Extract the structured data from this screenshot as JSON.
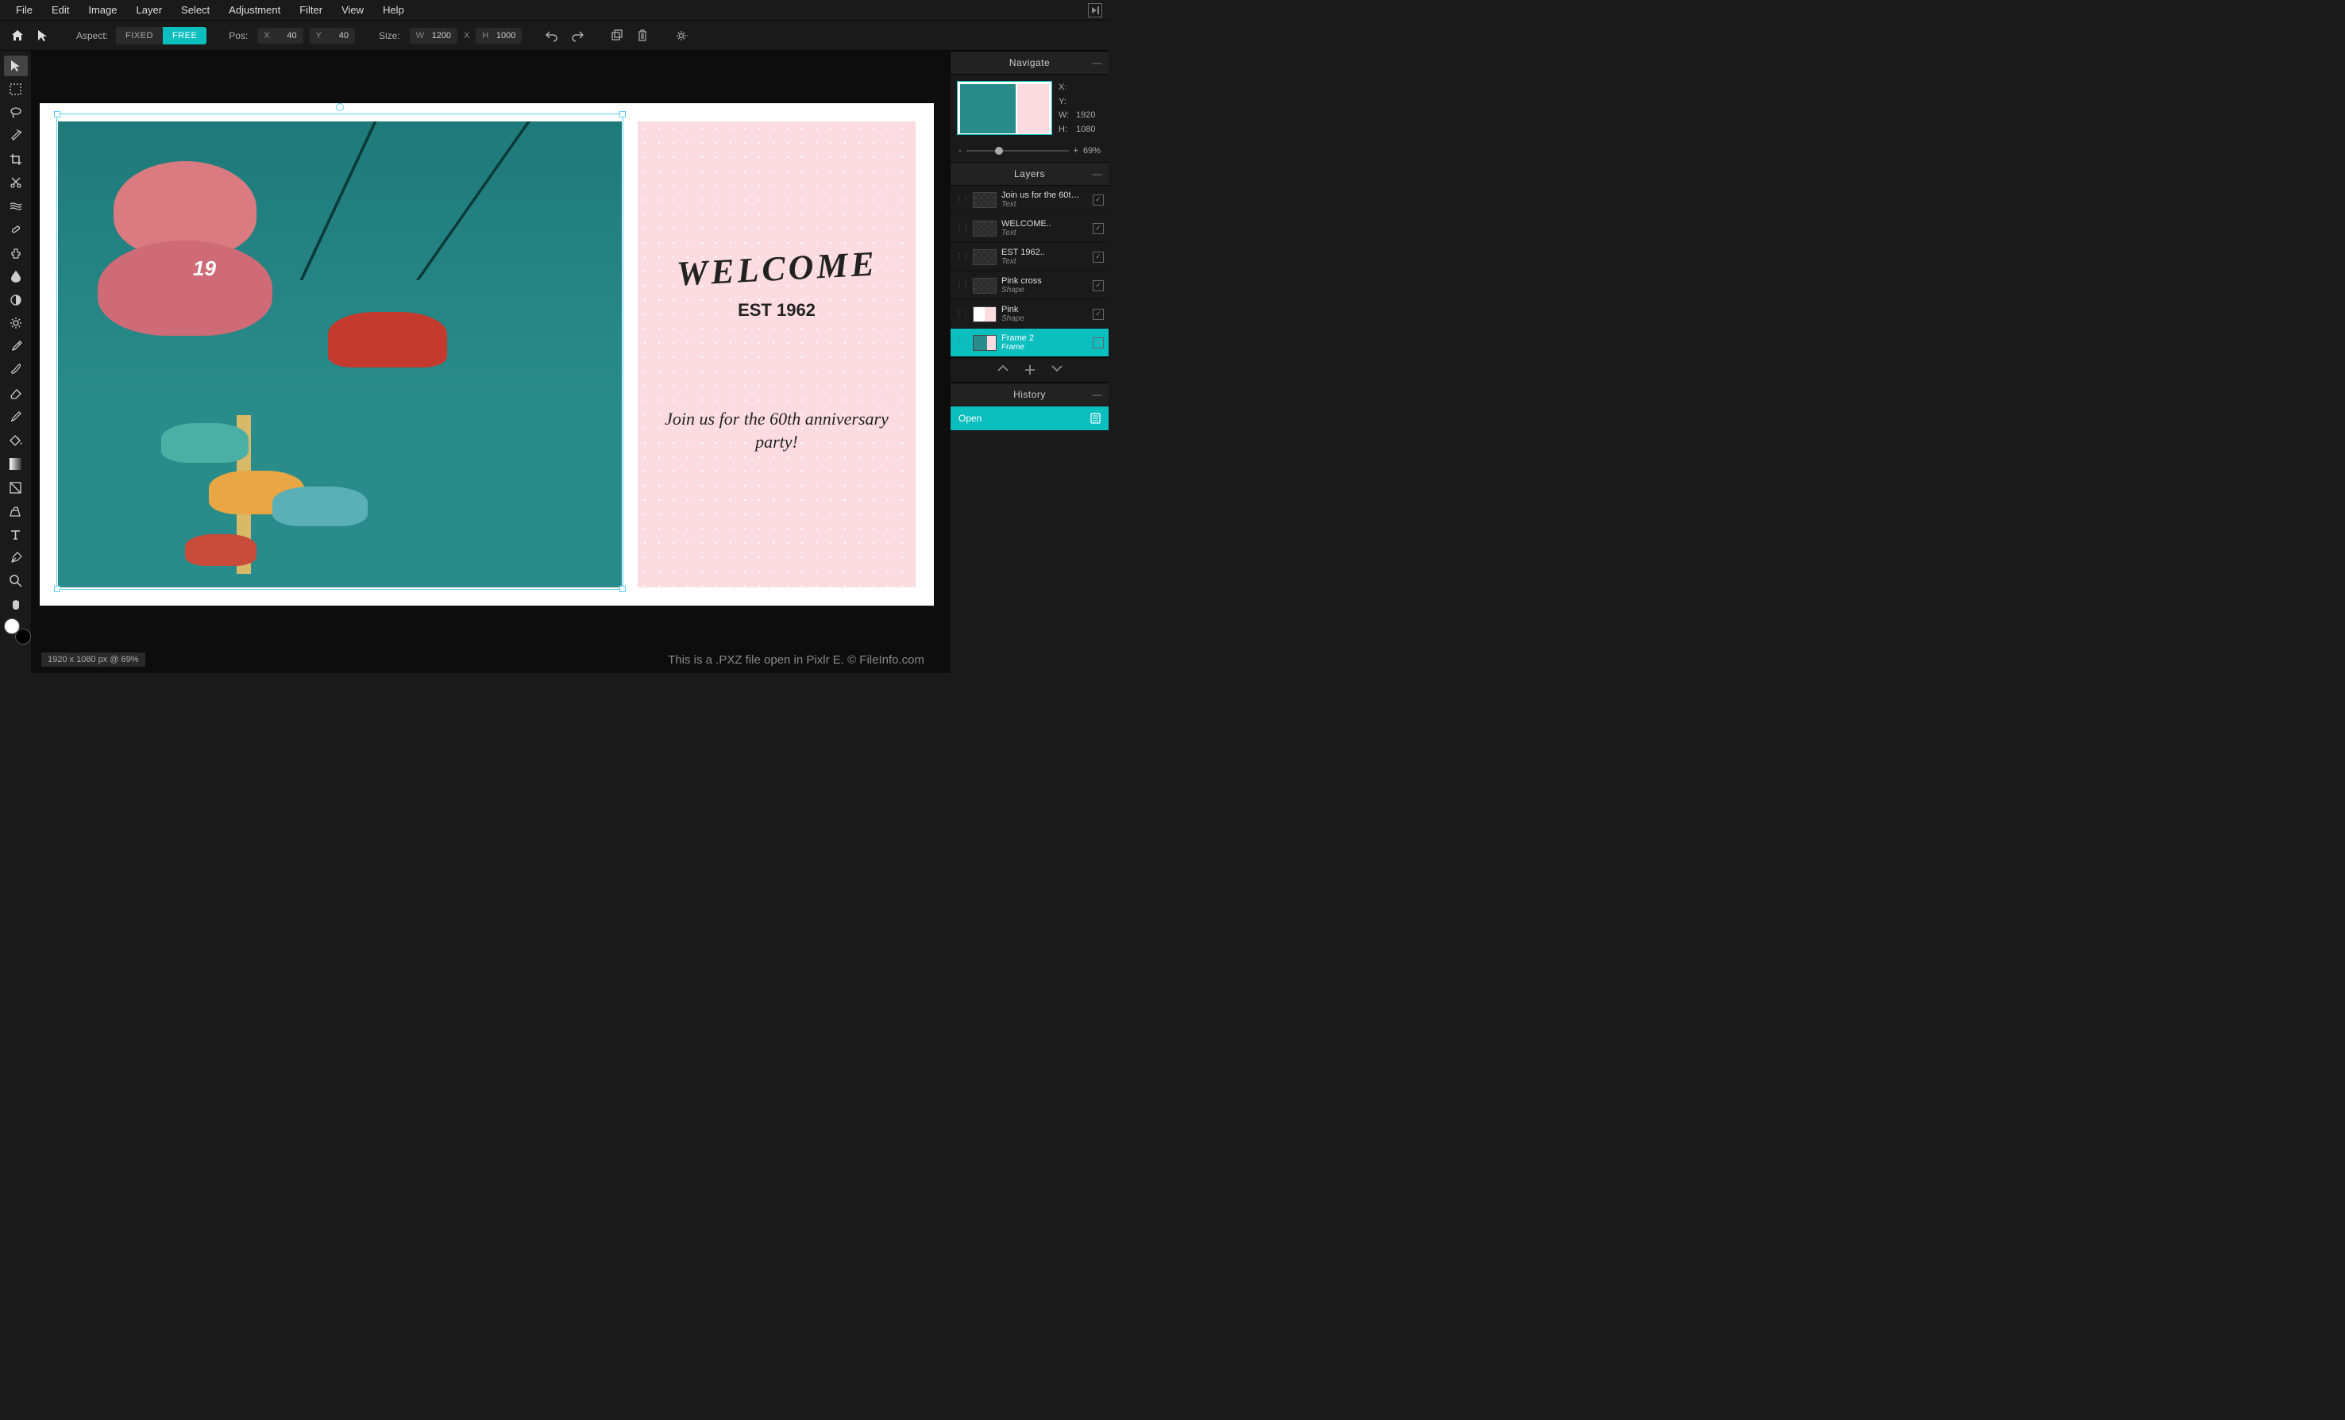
{
  "menubar": {
    "items": [
      "File",
      "Edit",
      "Image",
      "Layer",
      "Select",
      "Adjustment",
      "Filter",
      "View",
      "Help"
    ]
  },
  "toolbar": {
    "aspect_label": "Aspect:",
    "fixed": "FIXED",
    "free": "FREE",
    "pos_label": "Pos:",
    "pos_x_label": "X",
    "pos_x": "40",
    "pos_y_label": "Y",
    "pos_y": "40",
    "size_label": "Size:",
    "size_w_label": "W",
    "size_w": "1200",
    "x_sep": "X",
    "size_h_label": "H",
    "size_h": "1000"
  },
  "tools": [
    "arrow",
    "marquee",
    "lasso",
    "wand",
    "crop",
    "cut",
    "liquify",
    "heal",
    "stamp",
    "blur",
    "vignette",
    "sun",
    "eyedropper",
    "brush",
    "eraser",
    "colorreplace",
    "fill",
    "gradient",
    "nocrop",
    "paint",
    "text",
    "pen",
    "zoom",
    "hand"
  ],
  "canvas_content": {
    "nineteen": "19",
    "welcome": "WELCOME",
    "est": "EST 1962",
    "join": "Join us for the 60th anniversary party!"
  },
  "footer": {
    "status": "1920 x 1080 px @ 69%",
    "credit": "This is a .PXZ file open in Pixlr E. © FileInfo.com"
  },
  "navigate": {
    "title": "Navigate",
    "x_label": "X:",
    "y_label": "Y:",
    "w_label": "W:",
    "w_value": "1920",
    "h_label": "H:",
    "h_value": "1080",
    "zoom_minus": "-",
    "zoom_plus": "+",
    "zoom_pct": "69%"
  },
  "layers_panel": {
    "title": "Layers",
    "layers": [
      {
        "name": "Join us for the 60t…",
        "type": "Text",
        "thumb": "checker",
        "active": false
      },
      {
        "name": "WELCOME..",
        "type": "Text",
        "thumb": "checker",
        "active": false
      },
      {
        "name": "EST 1962..",
        "type": "Text",
        "thumb": "checker",
        "active": false
      },
      {
        "name": "Pink cross",
        "type": "Shape",
        "thumb": "checker",
        "active": false
      },
      {
        "name": "Pink",
        "type": "Shape",
        "thumb": "half",
        "active": false
      },
      {
        "name": "Frame 2",
        "type": "Frame",
        "thumb": "frame",
        "active": true
      }
    ]
  },
  "history_panel": {
    "title": "History",
    "items": [
      {
        "label": "Open"
      }
    ]
  }
}
